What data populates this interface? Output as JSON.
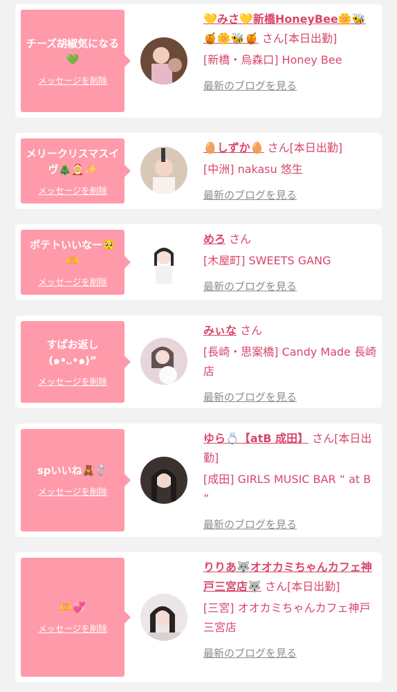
{
  "accent_color": "#ff9aaa",
  "name_color": "#d8456a",
  "items": [
    {
      "message": "チーズ胡椒気になる💚",
      "delete_label": "メッセージを削除",
      "name": "💛みさ💛新橋HoneyBee🌼🐝🍯🌼🐝🍯",
      "status": "さん[本日出勤]",
      "shop": "[新橋・烏森口] Honey Bee",
      "blog_label": "最新のブログを見る"
    },
    {
      "message": "メリークリスマスイヴ🎄🤶✨",
      "delete_label": "メッセージを削除",
      "name": "🥚しずか🥚",
      "status": "さん[本日出勤]",
      "shop": "[中洲] nakasu 悠生",
      "blog_label": "最新のブログを見る"
    },
    {
      "message": "ポテトいいなー🥺🫶",
      "delete_label": "メッセージを削除",
      "name": "めろ",
      "status": "さん",
      "shop": "[木屋町] SWEETS GANG",
      "blog_label": "最新のブログを見る"
    },
    {
      "message": "すぱお返し(๑•᎑•๑)”",
      "delete_label": "メッセージを削除",
      "name": "みぃな",
      "status": "さん",
      "shop": "[長崎・思案橋] Candy Made 長崎店",
      "blog_label": "最新のブログを見る"
    },
    {
      "message": "spいいね🧸💍",
      "delete_label": "メッセージを削除",
      "name": "ゆら💍【atB 成田】",
      "status": "さん[本日出勤]",
      "shop": "[成田] GIRLS MUSIC BAR “ at B ”",
      "blog_label": "最新のブログを見る"
    },
    {
      "message": "🫶💞",
      "delete_label": "メッセージを削除",
      "name": "りりあ🐺オオカミちゃんカフェ神戸三宮店🐺",
      "status": "さん[本日出勤]",
      "shop": "[三宮] オオカミちゃんカフェ神戸三宮店",
      "blog_label": "最新のブログを見る"
    }
  ]
}
